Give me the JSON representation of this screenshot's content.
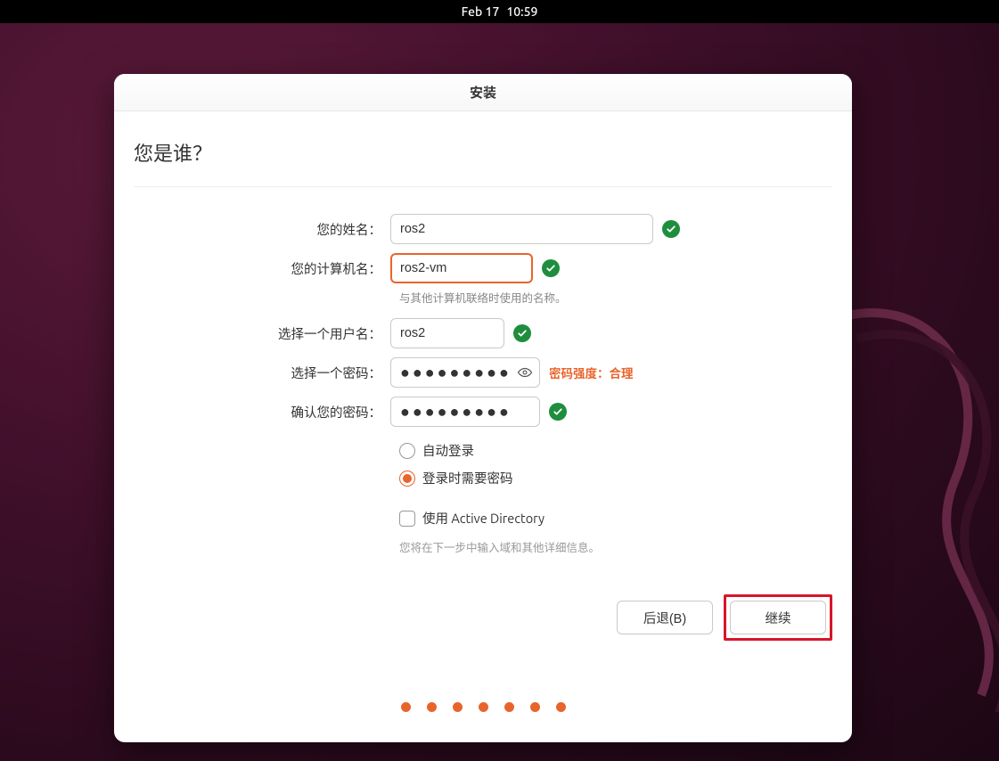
{
  "topbar": {
    "date": "Feb 17",
    "time": "10:59"
  },
  "window": {
    "title": "安装"
  },
  "page": {
    "heading": "您是谁？",
    "labels": {
      "name": "您的姓名：",
      "hostname": "您的计算机名：",
      "hostname_hint": "与其他计算机联络时使用的名称。",
      "username": "选择一个用户名：",
      "password": "选择一个密码：",
      "confirm": "确认您的密码："
    },
    "values": {
      "name": "ros2",
      "hostname": "ros2-vm",
      "username": "ros2",
      "password": "●●●●●●●●●",
      "confirm": "●●●●●●●●●"
    },
    "password_strength": "密码强度：合理",
    "radios": {
      "auto_login": "自动登录",
      "require_pw": "登录时需要密码"
    },
    "ad": {
      "label": "使用 Active Directory",
      "hint": "您将在下一步中输入域和其他详细信息。"
    },
    "buttons": {
      "back": "后退(B)",
      "continue": "继续"
    }
  }
}
